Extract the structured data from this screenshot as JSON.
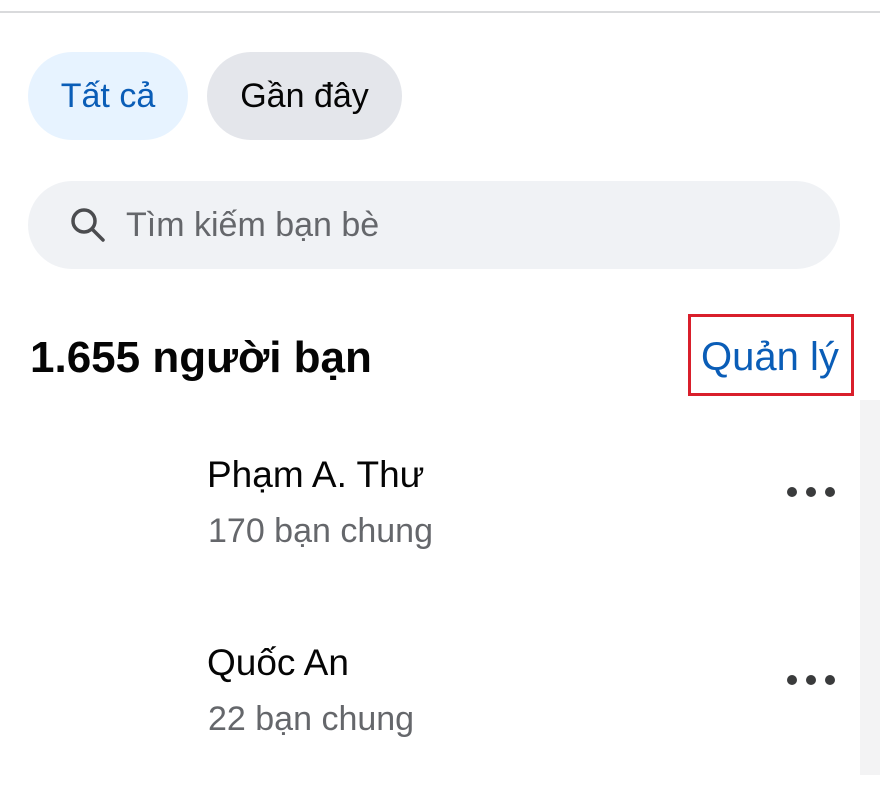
{
  "filters": {
    "all_label": "Tất cả",
    "recent_label": "Gần đây"
  },
  "search": {
    "placeholder": "Tìm kiếm bạn bè",
    "value": ""
  },
  "friends": {
    "count_label": "1.655 người bạn",
    "manage_label": "Quản lý",
    "items": [
      {
        "name": "Phạm A. Thư",
        "mutual": "170 bạn chung"
      },
      {
        "name": "Quốc An",
        "mutual": "22 bạn chung"
      }
    ]
  },
  "colors": {
    "accent": "#0a5db7",
    "highlight_box": "#d91f2b",
    "chip_active_bg": "#e7f3ff",
    "chip_bg": "#e4e6eb",
    "search_bg": "#f0f2f5"
  }
}
